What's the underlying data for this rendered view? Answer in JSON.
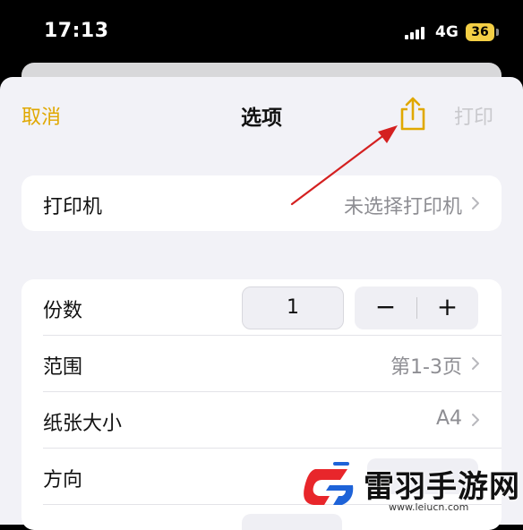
{
  "status_bar": {
    "time": "17:13",
    "network": "4G",
    "battery": "36"
  },
  "nav": {
    "cancel_label": "取消",
    "title": "选项",
    "share_icon": "share-icon",
    "print_label": "打印"
  },
  "printer_row": {
    "label": "打印机",
    "value": "未选择打印机"
  },
  "options": {
    "copies": {
      "label": "份数",
      "value": "1",
      "minus": "−",
      "plus": "+"
    },
    "range": {
      "label": "范围",
      "value": "第1-3页"
    },
    "paper_size": {
      "label": "纸张大小",
      "value": "A4"
    },
    "orientation": {
      "label": "方向"
    }
  },
  "watermark": {
    "title": "雷羽手游网",
    "url": "www.leiucn.com"
  },
  "colors": {
    "accent": "#e0a800",
    "disabled": "#c9c9cd",
    "annotation_arrow": "#d42020",
    "watermark_red": "#e8262b",
    "watermark_blue": "#1e63d8"
  }
}
